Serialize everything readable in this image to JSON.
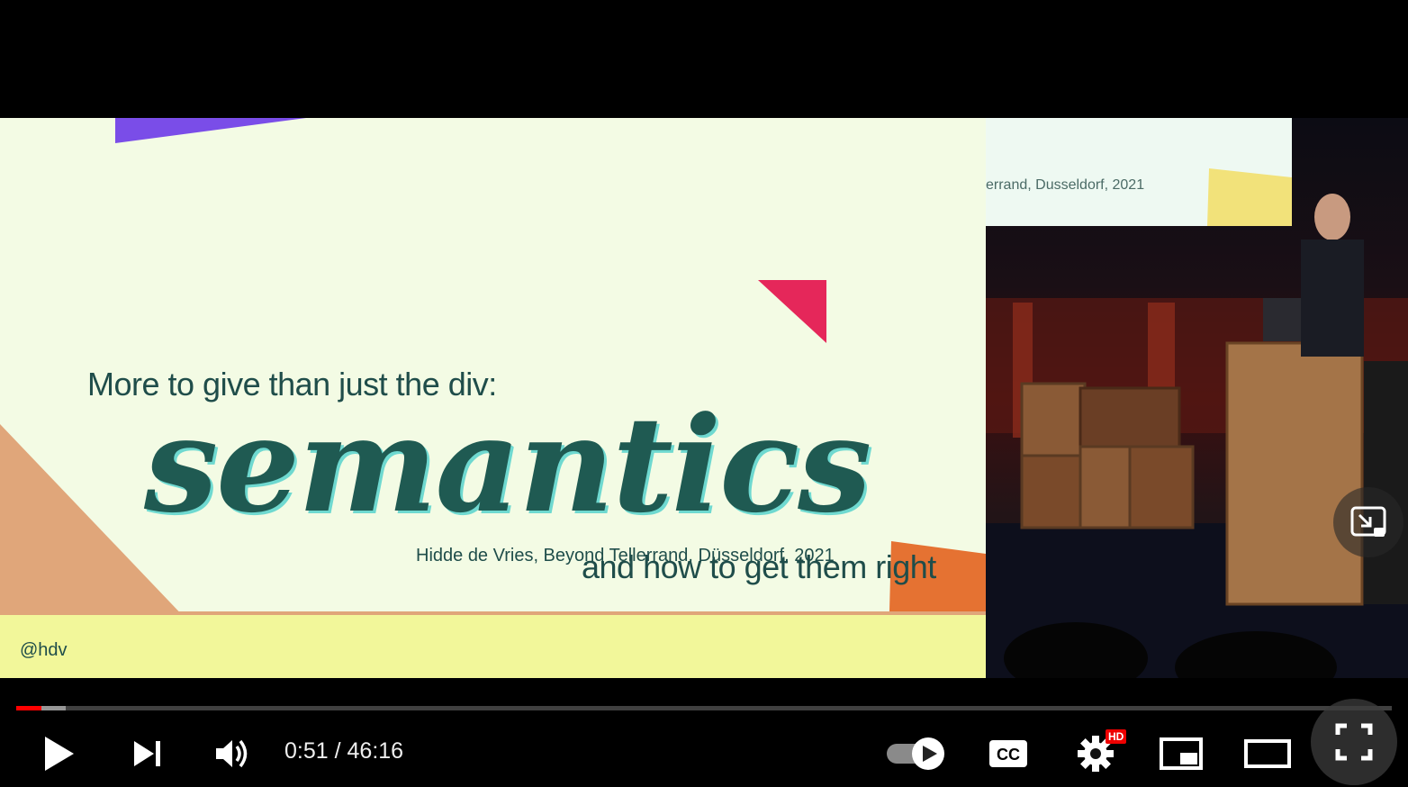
{
  "slide": {
    "subtitle": "More to give than just the div:",
    "title": "semantics",
    "tagline": "and how to get them right",
    "author": "Hidde de Vries, Beyond Tellerrand, Düsseldorf, 2021",
    "handle": "@hdv"
  },
  "stage_screen": {
    "text": "errand, Dusseldorf, 2021"
  },
  "player": {
    "current_time": "0:51",
    "separator": " / ",
    "duration": "46:16",
    "progress_played": 0.018,
    "progress_buffered": 0.036,
    "quality_badge": "HD",
    "colors": {
      "played": "#ff0000",
      "badge": "#ee0000"
    }
  }
}
